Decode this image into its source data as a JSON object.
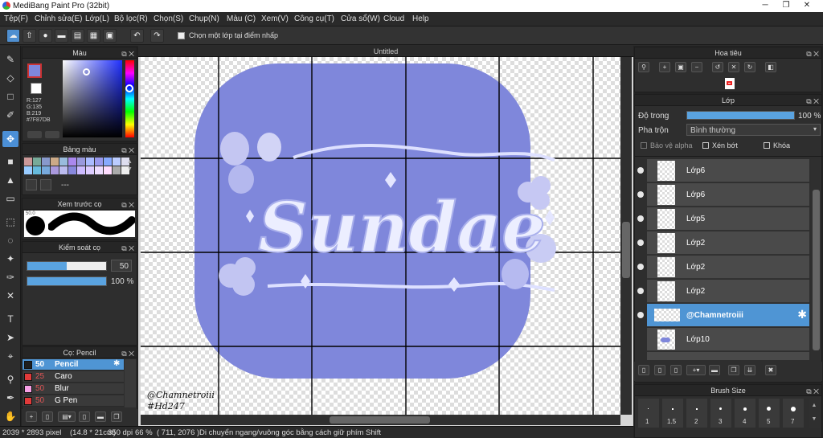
{
  "app": {
    "title": "MediBang Paint Pro (32bit)"
  },
  "menu": [
    "Tệp(F)",
    "Chỉnh sửa(E)",
    "Lớp(L)",
    "Bộ lọc(R)",
    "Chọn(S)",
    "Chụp(N)",
    "Màu (C)",
    "Xem(V)",
    "Công cụ(T)",
    "Cửa sổ(W)",
    "Cloud",
    "Help"
  ],
  "toolbar": {
    "checkbox_label": "Chọn một lớp tại điểm nhấp"
  },
  "color_panel": {
    "title": "Màu",
    "r": "R:127",
    "g": "G:135",
    "b": "B:219",
    "hex": "#7F87DB",
    "fg_color": "#7F87DB",
    "bg_color": "#FFFFFF"
  },
  "palette_panel": {
    "title": "Bảng màu",
    "extra": "---"
  },
  "brush_preview": {
    "title": "Xem trước cọ",
    "size": "50.0"
  },
  "control_panel": {
    "title": "Kiểm soát cọ",
    "size_value": "50",
    "opacity_value": "100 %",
    "size_fraction": 0.5,
    "opacity_fraction": 1.0
  },
  "brush_panel": {
    "title": "Cọ: Pencil",
    "items": [
      {
        "size": "50",
        "name": "Pencil",
        "color": "#1e1e1e"
      },
      {
        "size": "25",
        "name": "Caro",
        "color": "#e03a3a"
      },
      {
        "size": "50",
        "name": "Blur",
        "color": "#f7a0e6"
      },
      {
        "size": "50",
        "name": "G Pen",
        "color": "#e03a3a"
      }
    ]
  },
  "document": {
    "tab": "Untitled",
    "signature_line1": "@Chamnetroiii",
    "signature_line2": "#Hd247",
    "artwork_word": "Sundae",
    "blob_color": "#7F87DB"
  },
  "navigator_panel": {
    "title": "Hoa tiêu"
  },
  "layer_panel": {
    "title": "Lớp",
    "opacity_label": "Độ trong",
    "opacity_value": "100 %",
    "opacity_fraction": 1.0,
    "blend_label": "Pha trộn",
    "blend_value": "Bình thường",
    "protect_alpha": "Bảo vệ alpha",
    "clipping": "Xén bớt",
    "lock": "Khóa",
    "layers": [
      {
        "name": "Lớp6"
      },
      {
        "name": "Lớp6"
      },
      {
        "name": "Lớp5"
      },
      {
        "name": "Lớp2"
      },
      {
        "name": "Lớp2"
      },
      {
        "name": "Lớp2"
      },
      {
        "name": "@Chamnetroiii"
      },
      {
        "name": "Lớp10"
      }
    ]
  },
  "brush_size_panel": {
    "title": "Brush Size",
    "sizes": [
      "1",
      "1.5",
      "2",
      "3",
      "4",
      "5",
      "7"
    ]
  },
  "status": {
    "dims": "2039 * 2893 pixel",
    "cm": "(14.8 * 21cm)",
    "dpi": "350 dpi",
    "zoom": "66 %",
    "coords": "( 711, 2076 )",
    "hint": "Di chuyển ngang/vuông góc bằng cách giữ phím Shift"
  }
}
